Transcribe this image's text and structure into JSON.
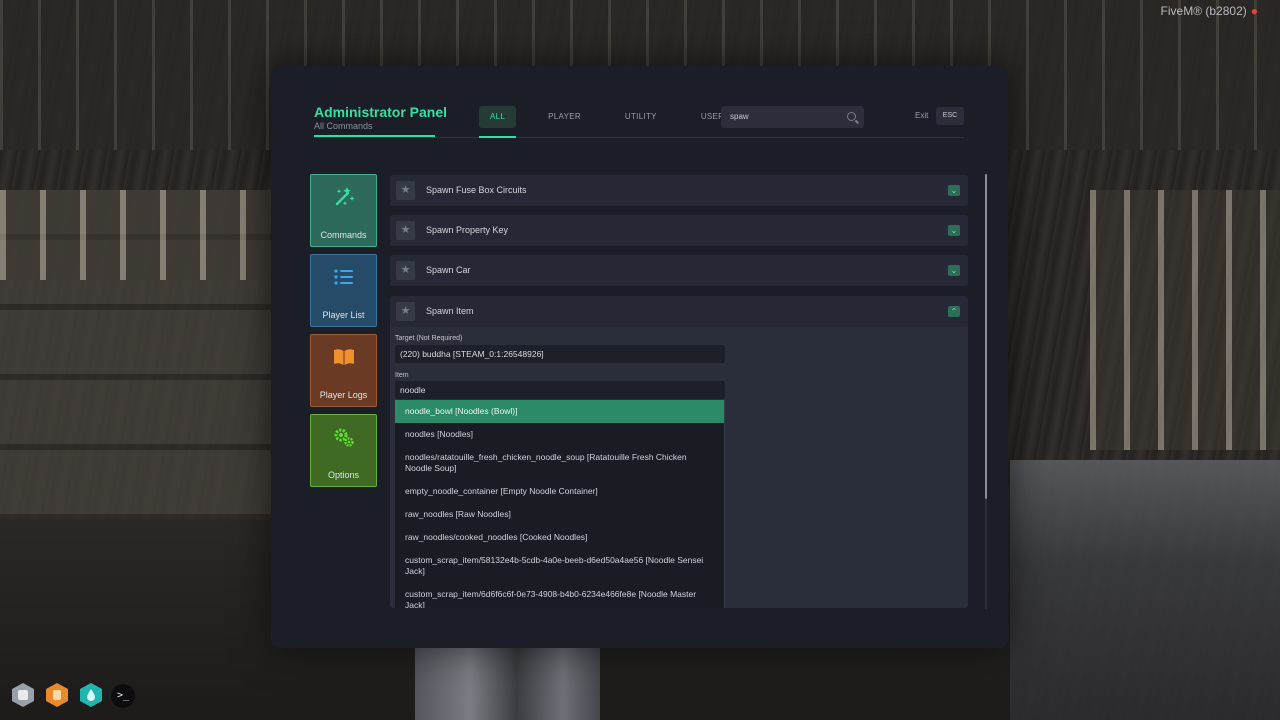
{
  "overlay": {
    "fivem_tag": "FiveM® (b2802)"
  },
  "panel": {
    "title": "Administrator Panel",
    "subtitle": "All Commands",
    "tabs": [
      {
        "label": "ALL",
        "active": true
      },
      {
        "label": "PLAYER",
        "active": false
      },
      {
        "label": "UTILITY",
        "active": false
      },
      {
        "label": "USER",
        "active": false
      }
    ],
    "search": {
      "value": "spaw"
    },
    "exit_label": "Exit",
    "esc_key": "ESC"
  },
  "sidebar": {
    "items": [
      {
        "label": "Commands",
        "icon": "wand-sparkles-icon",
        "color": "#34e0a0"
      },
      {
        "label": "Player List",
        "icon": "list-icon",
        "color": "#3aa8e8"
      },
      {
        "label": "Player Logs",
        "icon": "book-icon",
        "color": "#f0902c"
      },
      {
        "label": "Options",
        "icon": "gears-icon",
        "color": "#5ee030"
      }
    ]
  },
  "commands": [
    {
      "label": "Spawn Fuse Box Circuits",
      "expanded": false
    },
    {
      "label": "Spawn Property Key",
      "expanded": false
    },
    {
      "label": "Spawn Car",
      "expanded": false
    },
    {
      "label": "Spawn Item",
      "expanded": true
    }
  ],
  "spawn_item": {
    "target_label": "Target (Not Required)",
    "target_value": "(220) buddha [STEAM_0:1:26548926]",
    "item_label": "Item",
    "item_value": "noodle",
    "results": [
      "noodle_bowl [Noodles (Bowl)]",
      "noodles [Noodles]",
      "noodles/ratatouille_fresh_chicken_noodle_soup [Ratatouille Fresh Chicken Noodle Soup]",
      "empty_noodle_container [Empty Noodle Container]",
      "raw_noodles [Raw Noodles]",
      "raw_noodles/cooked_noodles [Cooked Noodles]",
      "custom_scrap_item/58132e4b-5cdb-4a0e-beeb-d6ed50a4ae56 [Noodle Sensei Jack]",
      "custom_scrap_item/6d6f6c6f-0e73-4908-b4b0-6234e466fe8e [Noodle Master Jack]"
    ],
    "selected_index": 0
  },
  "hud": {
    "icons": [
      "armor-icon",
      "hunger-icon",
      "thirst-icon"
    ],
    "console_glyph": ">_"
  },
  "colors": {
    "accent": "#34e0a0",
    "panel_bg": "#1c1e27",
    "row_bg": "#262935",
    "selected": "#2b8a68"
  }
}
